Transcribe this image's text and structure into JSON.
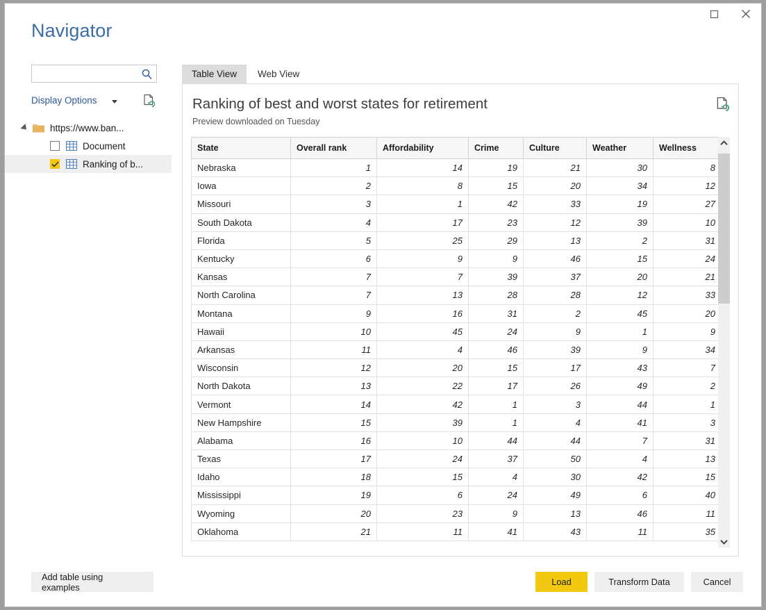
{
  "window": {
    "title": "Navigator",
    "controls": {
      "maximize": "maximize-icon",
      "close": "close-icon"
    }
  },
  "sidebar": {
    "search": {
      "value": "",
      "placeholder": "",
      "icon": "search-icon"
    },
    "display_options": {
      "label": "Display Options",
      "caret": "chevron-down-icon",
      "refresh_icon": "document-refresh-icon"
    },
    "tree": [
      {
        "label": "https://www.ban...",
        "level": 0,
        "icon": "folder-icon",
        "expanded": true,
        "checkbox": null,
        "selected": false
      },
      {
        "label": "Document",
        "level": 1,
        "icon": "table-icon",
        "checkbox": "unchecked",
        "selected": false
      },
      {
        "label": "Ranking of b...",
        "level": 1,
        "icon": "table-icon",
        "checkbox": "checked",
        "selected": true
      }
    ]
  },
  "main": {
    "tabs": [
      {
        "label": "Table View",
        "active": true
      },
      {
        "label": "Web View",
        "active": false
      }
    ],
    "panel": {
      "title": "Ranking of best and worst states for retirement",
      "subtitle": "Preview downloaded on Tuesday",
      "refresh_icon": "document-refresh-icon"
    },
    "table": {
      "columns": [
        "State",
        "Overall rank",
        "Affordability",
        "Crime",
        "Culture",
        "Weather",
        "Wellness"
      ],
      "rows": [
        [
          "Nebraska",
          "1",
          "14",
          "19",
          "21",
          "30",
          "8"
        ],
        [
          "Iowa",
          "2",
          "8",
          "15",
          "20",
          "34",
          "12"
        ],
        [
          "Missouri",
          "3",
          "1",
          "42",
          "33",
          "19",
          "27"
        ],
        [
          "South Dakota",
          "4",
          "17",
          "23",
          "12",
          "39",
          "10"
        ],
        [
          "Florida",
          "5",
          "25",
          "29",
          "13",
          "2",
          "31"
        ],
        [
          "Kentucky",
          "6",
          "9",
          "9",
          "46",
          "15",
          "24"
        ],
        [
          "Kansas",
          "7",
          "7",
          "39",
          "37",
          "20",
          "21"
        ],
        [
          "North Carolina",
          "7",
          "13",
          "28",
          "28",
          "12",
          "33"
        ],
        [
          "Montana",
          "9",
          "16",
          "31",
          "2",
          "45",
          "20"
        ],
        [
          "Hawaii",
          "10",
          "45",
          "24",
          "9",
          "1",
          "9"
        ],
        [
          "Arkansas",
          "11",
          "4",
          "46",
          "39",
          "9",
          "34"
        ],
        [
          "Wisconsin",
          "12",
          "20",
          "15",
          "17",
          "43",
          "7"
        ],
        [
          "North Dakota",
          "13",
          "22",
          "17",
          "26",
          "49",
          "2"
        ],
        [
          "Vermont",
          "14",
          "42",
          "1",
          "3",
          "44",
          "1"
        ],
        [
          "New Hampshire",
          "15",
          "39",
          "1",
          "4",
          "41",
          "3"
        ],
        [
          "Alabama",
          "16",
          "10",
          "44",
          "44",
          "7",
          "31"
        ],
        [
          "Texas",
          "17",
          "24",
          "37",
          "50",
          "4",
          "13"
        ],
        [
          "Idaho",
          "18",
          "15",
          "4",
          "30",
          "42",
          "15"
        ],
        [
          "Mississippi",
          "19",
          "6",
          "24",
          "49",
          "6",
          "40"
        ],
        [
          "Wyoming",
          "20",
          "23",
          "9",
          "13",
          "46",
          "11"
        ],
        [
          "Oklahoma",
          "21",
          "11",
          "41",
          "43",
          "11",
          "35"
        ]
      ]
    },
    "scrollbar": {
      "up_icon": "chevron-up-icon",
      "down_icon": "chevron-down-icon"
    }
  },
  "footer": {
    "add_table_label": "Add table using examples",
    "load_label": "Load",
    "transform_label": "Transform Data",
    "cancel_label": "Cancel"
  },
  "colors": {
    "accent": "#f2c811",
    "title": "#3b6ea5",
    "link": "#2b579a"
  }
}
